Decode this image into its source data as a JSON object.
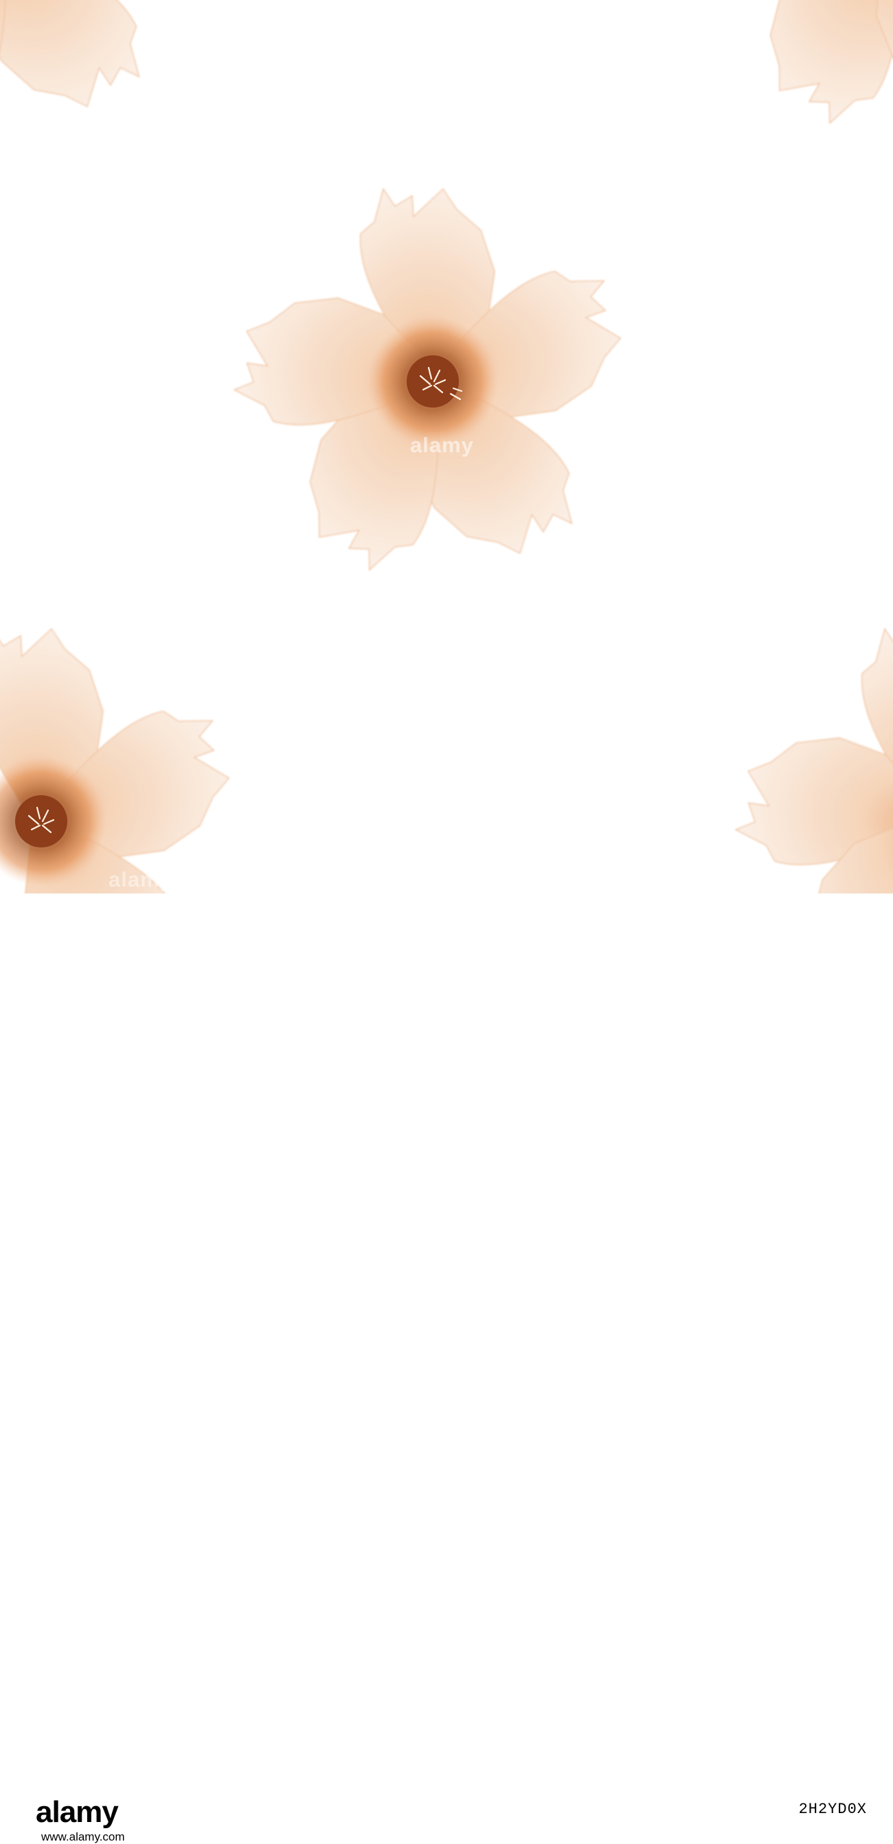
{
  "watermark_text": "alamy",
  "footer": {
    "logo": "alamy",
    "image_id": "2H2YD0X",
    "url": "www.alamy.com",
    "caption": ""
  },
  "palette": {
    "petal": "#f7dcc6",
    "petal_edge": "#f1c8a4",
    "petal_light": "#fbeee4",
    "center_glow": "#e8935a",
    "center": "#9a4a22",
    "stamen": "#fff4ea"
  },
  "scene": {
    "subject": "watercolor peach flower repeating pattern",
    "flowers_visible": 5
  }
}
